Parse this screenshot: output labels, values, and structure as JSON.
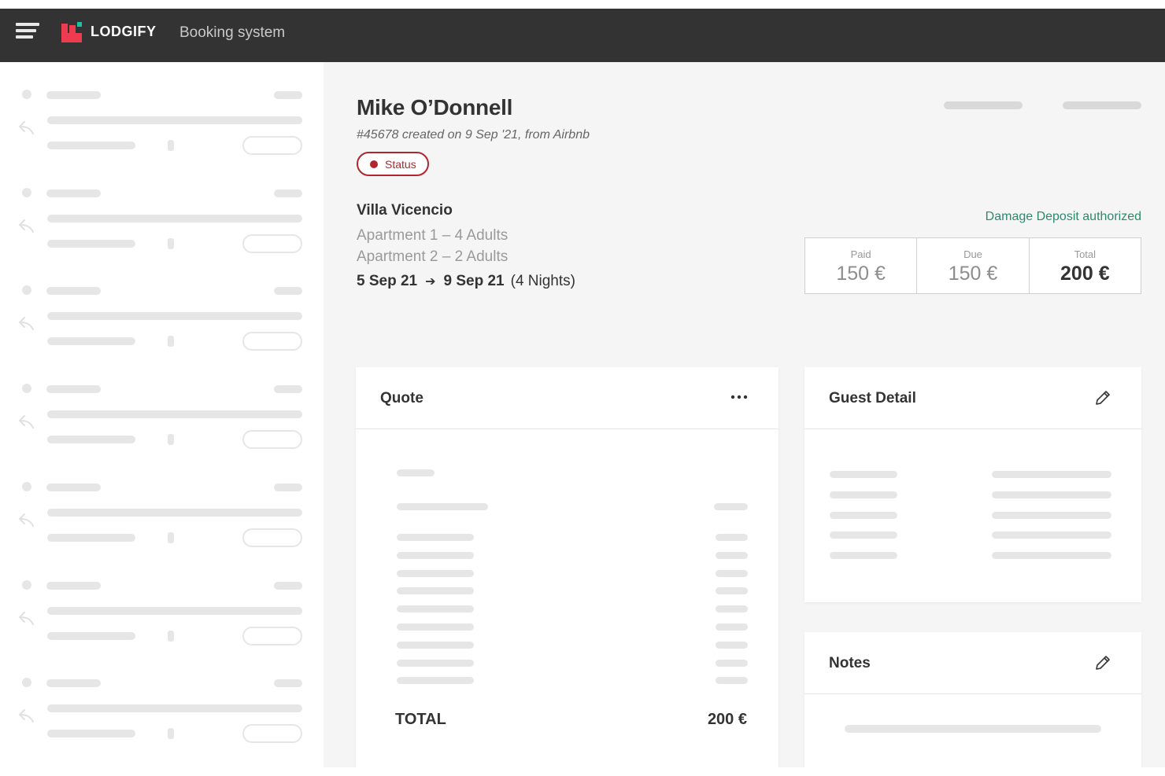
{
  "header": {
    "brand": "LODGIFY",
    "subtitle": "Booking system",
    "icons": {
      "menu": "hamburger-icon",
      "logo": "lodgify-logo"
    }
  },
  "colors": {
    "topbar": "#333333",
    "brand_red": "#ee3b4f",
    "brand_teal": "#1fc1a4",
    "status": "#b0262e",
    "deposit": "#2b8a6e"
  },
  "booking": {
    "guest_name": "Mike O’Donnell",
    "meta": "#45678 created on 9 Sep '21, from Airbnb",
    "status": "Status",
    "property": "Villa Vicencio",
    "apartments": [
      "Apartment 1 – 4 Adults",
      "Apartment 2 – 2 Adults"
    ],
    "check_in": "5 Sep 21",
    "check_out": "9 Sep 21",
    "nights": "(4 Nights)",
    "deposit_text": "Damage Deposit authorized"
  },
  "payment": {
    "paid_label": "Paid",
    "paid_value": "150 €",
    "due_label": "Due",
    "due_value": "150 €",
    "total_label": "Total",
    "total_value": "200 €"
  },
  "quote": {
    "title": "Quote",
    "menu_icon": "more-horizontal-icon",
    "total_label": "TOTAL",
    "total_value": "200 €"
  },
  "guest_detail": {
    "title": "Guest Detail",
    "edit_icon": "pencil-icon"
  },
  "notes": {
    "title": "Notes",
    "edit_icon": "pencil-icon"
  }
}
